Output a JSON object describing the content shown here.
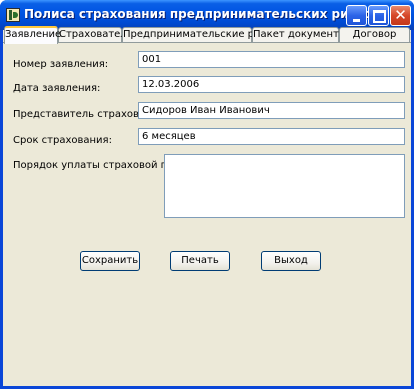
{
  "window": {
    "title": "Полиса страхования предпринимательских рисков",
    "icon": "app-icon",
    "controls": {
      "minimize": "minimize-icon",
      "maximize": "maximize-icon",
      "close": "close-icon"
    }
  },
  "tabs": [
    {
      "label": "Заявление",
      "active": true
    },
    {
      "label": "Страхователь",
      "active": false
    },
    {
      "label": "Предпринимательские риски",
      "active": false
    },
    {
      "label": "Пакет документов",
      "active": false
    },
    {
      "label": "Договор",
      "active": false
    }
  ],
  "form": {
    "application_number": {
      "label": "Номер заявления:",
      "value": "001"
    },
    "application_date": {
      "label": "Дата заявления:",
      "value": "12.03.2006"
    },
    "insurer_representative": {
      "label": "Представитель страховщика:",
      "value": "Сидоров Иван Иванович"
    },
    "insurance_term": {
      "label": "Срок страхования:",
      "value": "6 месяцев"
    },
    "premium_payment_order": {
      "label": "Порядок уплаты страховой премии:",
      "value": ""
    }
  },
  "buttons": {
    "save": "Сохранить",
    "print": "Печать",
    "exit": "Выход"
  },
  "colors": {
    "titlebar": "#0054e3",
    "window_frame": "#0a46d8",
    "dialog_background": "#ece9d8",
    "active_tab_accent": "#ffc73c",
    "input_border": "#7f9db9"
  }
}
